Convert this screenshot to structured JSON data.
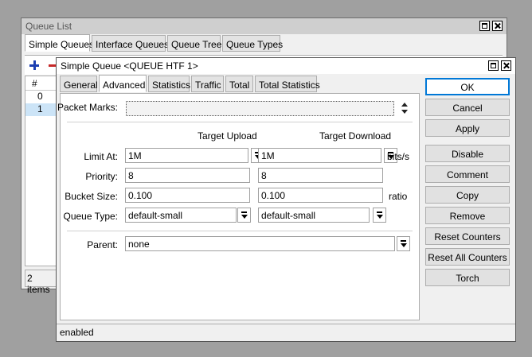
{
  "queue_list": {
    "title": "Queue List",
    "tabs": [
      "Simple Queues",
      "Interface Queues",
      "Queue Tree",
      "Queue Types"
    ],
    "table_header": "#",
    "rows": [
      "0",
      "1"
    ],
    "status": "2 items"
  },
  "dialog": {
    "title": "Simple Queue <QUEUE HTF 1>",
    "tabs": [
      "General",
      "Advanced",
      "Statistics",
      "Traffic",
      "Total",
      "Total Statistics"
    ],
    "packet_marks_label": "Packet Marks:",
    "packet_marks_value": "",
    "col_upload": "Target Upload",
    "col_download": "Target Download",
    "limit_at": {
      "label": "Limit At:",
      "upload": "1M",
      "download": "1M",
      "unit": "bits/s"
    },
    "priority": {
      "label": "Priority:",
      "upload": "8",
      "download": "8"
    },
    "bucket_size": {
      "label": "Bucket Size:",
      "upload": "0.100",
      "download": "0.100",
      "unit": "ratio"
    },
    "queue_type": {
      "label": "Queue Type:",
      "upload": "default-small",
      "download": "default-small"
    },
    "parent": {
      "label": "Parent:",
      "value": "none"
    },
    "buttons": [
      "OK",
      "Cancel",
      "Apply",
      "Disable",
      "Comment",
      "Copy",
      "Remove",
      "Reset Counters",
      "Reset All Counters",
      "Torch"
    ],
    "status": "enabled"
  }
}
